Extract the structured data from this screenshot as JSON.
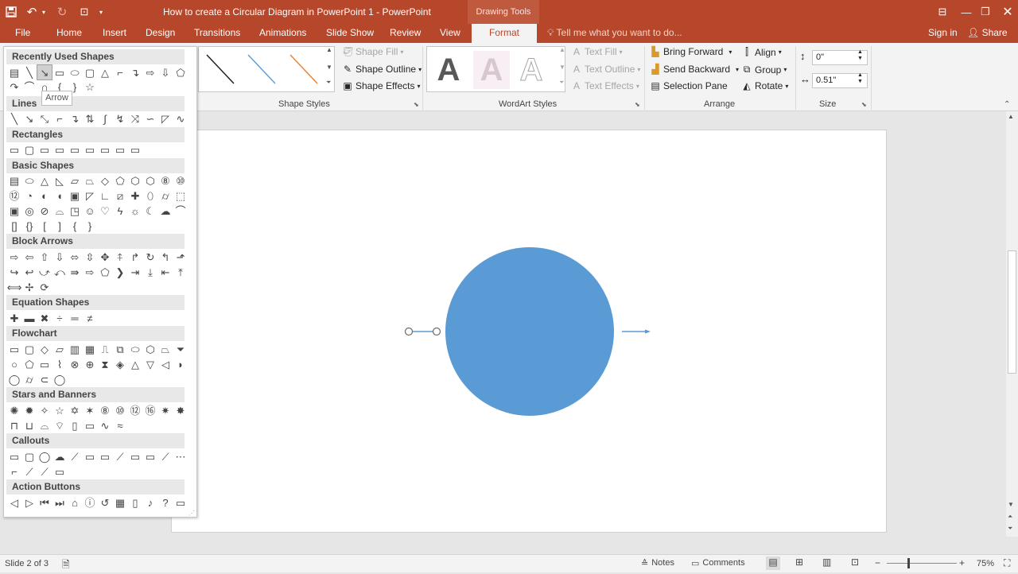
{
  "window": {
    "doc_title": "How to create a Circular Diagram in PowerPoint 1 - PowerPoint",
    "context_group": "Drawing Tools"
  },
  "tabs": [
    "File",
    "Home",
    "Insert",
    "Design",
    "Transitions",
    "Animations",
    "Slide Show",
    "Review",
    "View",
    "Format"
  ],
  "tell_me": "Tell me what you want to do...",
  "account": {
    "sign_in": "Sign in",
    "share": "Share"
  },
  "ribbon": {
    "shape_fill": "Shape Fill",
    "shape_outline": "Shape Outline",
    "shape_effects": "Shape Effects",
    "shape_styles_label": "Shape Styles",
    "text_fill": "Text Fill",
    "text_outline": "Text Outline",
    "text_effects": "Text Effects",
    "wordart_label": "WordArt Styles",
    "wordart_letter": "A",
    "bring_forward": "Bring Forward",
    "send_backward": "Send Backward",
    "selection_pane": "Selection Pane",
    "align": "Align",
    "group": "Group",
    "rotate": "Rotate",
    "arrange_label": "Arrange",
    "height_value": "0\"",
    "width_value": "0.51\"",
    "size_label": "Size"
  },
  "gallery": {
    "sections": [
      "Recently Used Shapes",
      "Lines",
      "Rectangles",
      "Basic Shapes",
      "Block Arrows",
      "Equation Shapes",
      "Flowchart",
      "Stars and Banners",
      "Callouts",
      "Action Buttons"
    ],
    "tooltip": "Arrow"
  },
  "status": {
    "slide_info": "Slide 2 of 3",
    "notes": "Notes",
    "comments": "Comments",
    "zoom": "75%"
  },
  "colors": {
    "brand": "#b7472a",
    "circle": "#5b9bd5",
    "line_style_black": "#1a1a1a",
    "line_style_blue": "#5b9bd5",
    "line_style_orange": "#ed7d31"
  }
}
